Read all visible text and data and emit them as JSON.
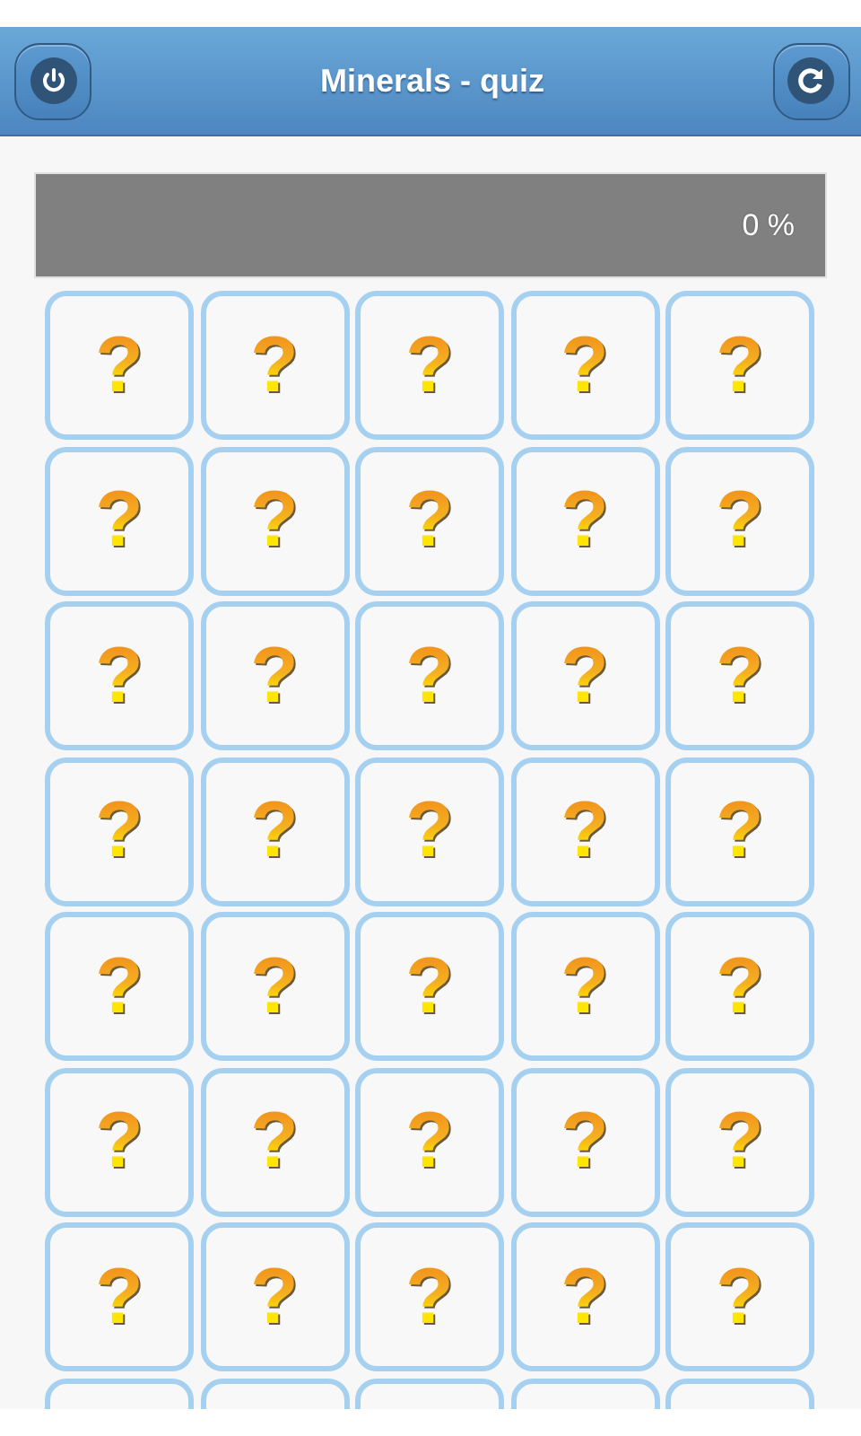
{
  "header": {
    "title": "Minerals - quiz",
    "buttons": [
      {
        "kind": "power"
      },
      {
        "kind": "refresh"
      }
    ]
  },
  "progress": {
    "level": 0,
    "reading": "0 %"
  },
  "tiles": [
    {
      "kind": "card",
      "label": "?"
    },
    {
      "kind": "card",
      "label": "?"
    },
    {
      "kind": "card",
      "label": "?"
    },
    {
      "kind": "card",
      "label": "?"
    },
    {
      "kind": "card",
      "label": "?"
    },
    {
      "kind": "card",
      "label": "?"
    },
    {
      "kind": "card",
      "label": "?"
    },
    {
      "kind": "card",
      "label": "?"
    },
    {
      "kind": "card",
      "label": "?"
    },
    {
      "kind": "card",
      "label": "?"
    },
    {
      "kind": "card",
      "label": "?"
    },
    {
      "kind": "card",
      "label": "?"
    },
    {
      "kind": "card",
      "label": "?"
    },
    {
      "kind": "card",
      "label": "?"
    },
    {
      "kind": "card",
      "label": "?"
    },
    {
      "kind": "card",
      "label": "?"
    },
    {
      "kind": "card",
      "label": "?"
    },
    {
      "kind": "card",
      "label": "?"
    },
    {
      "kind": "card",
      "label": "?"
    },
    {
      "kind": "card",
      "label": "?"
    },
    {
      "kind": "card",
      "label": "?"
    },
    {
      "kind": "card",
      "label": "?"
    },
    {
      "kind": "card",
      "label": "?"
    },
    {
      "kind": "card",
      "label": "?"
    },
    {
      "kind": "card",
      "label": "?"
    },
    {
      "kind": "card",
      "label": "?"
    },
    {
      "kind": "card",
      "label": "?"
    },
    {
      "kind": "card",
      "label": "?"
    },
    {
      "kind": "card",
      "label": "?"
    },
    {
      "kind": "card",
      "label": "?"
    },
    {
      "kind": "card",
      "label": "?"
    },
    {
      "kind": "card",
      "label": "?"
    },
    {
      "kind": "card",
      "label": "?"
    },
    {
      "kind": "card",
      "label": "?"
    },
    {
      "kind": "card",
      "label": "?"
    },
    {
      "kind": "blank"
    },
    {
      "kind": "blank"
    },
    {
      "kind": "blank"
    },
    {
      "kind": "blank"
    },
    {
      "kind": "blank"
    }
  ]
}
